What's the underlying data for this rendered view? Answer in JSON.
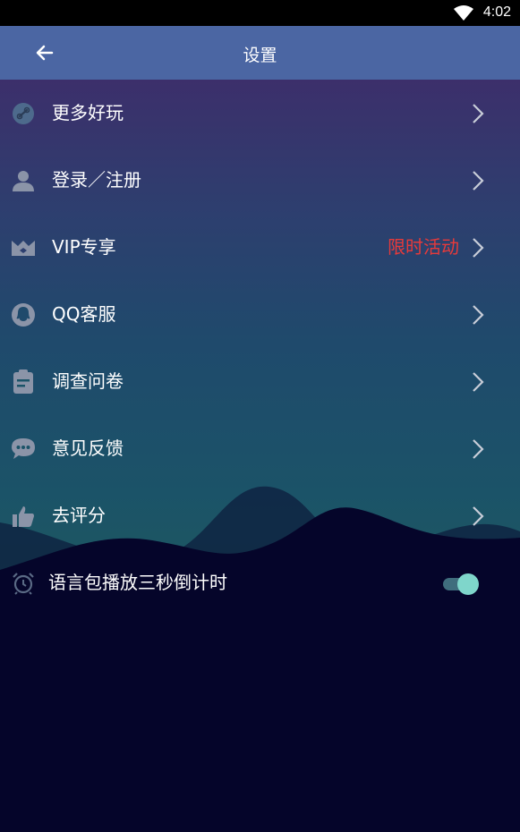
{
  "status_bar": {
    "time": "4:02",
    "wifi_icon": "wifi-icon"
  },
  "app_bar": {
    "title": "设置",
    "back_icon": "arrow-left-icon"
  },
  "menu": [
    {
      "label": "更多好玩",
      "icon": "link-icon",
      "extra": ""
    },
    {
      "label": "登录／注册",
      "icon": "user-icon",
      "extra": ""
    },
    {
      "label": "VIP专享",
      "icon": "crown-icon",
      "extra": "限时活动"
    },
    {
      "label": "QQ客服",
      "icon": "qq-icon",
      "extra": ""
    },
    {
      "label": "调查问卷",
      "icon": "clipboard-icon",
      "extra": ""
    },
    {
      "label": "意见反馈",
      "icon": "chat-icon",
      "extra": ""
    },
    {
      "label": "去评分",
      "icon": "thumbs-up-icon",
      "extra": ""
    }
  ],
  "countdown_setting": {
    "label": "语言包播放三秒倒计时",
    "icon": "alarm-icon",
    "enabled": true
  },
  "colors": {
    "accent_red": "#e83a3a",
    "toggle_on": "#7fd6cb",
    "app_bar": "#4b66a3"
  }
}
